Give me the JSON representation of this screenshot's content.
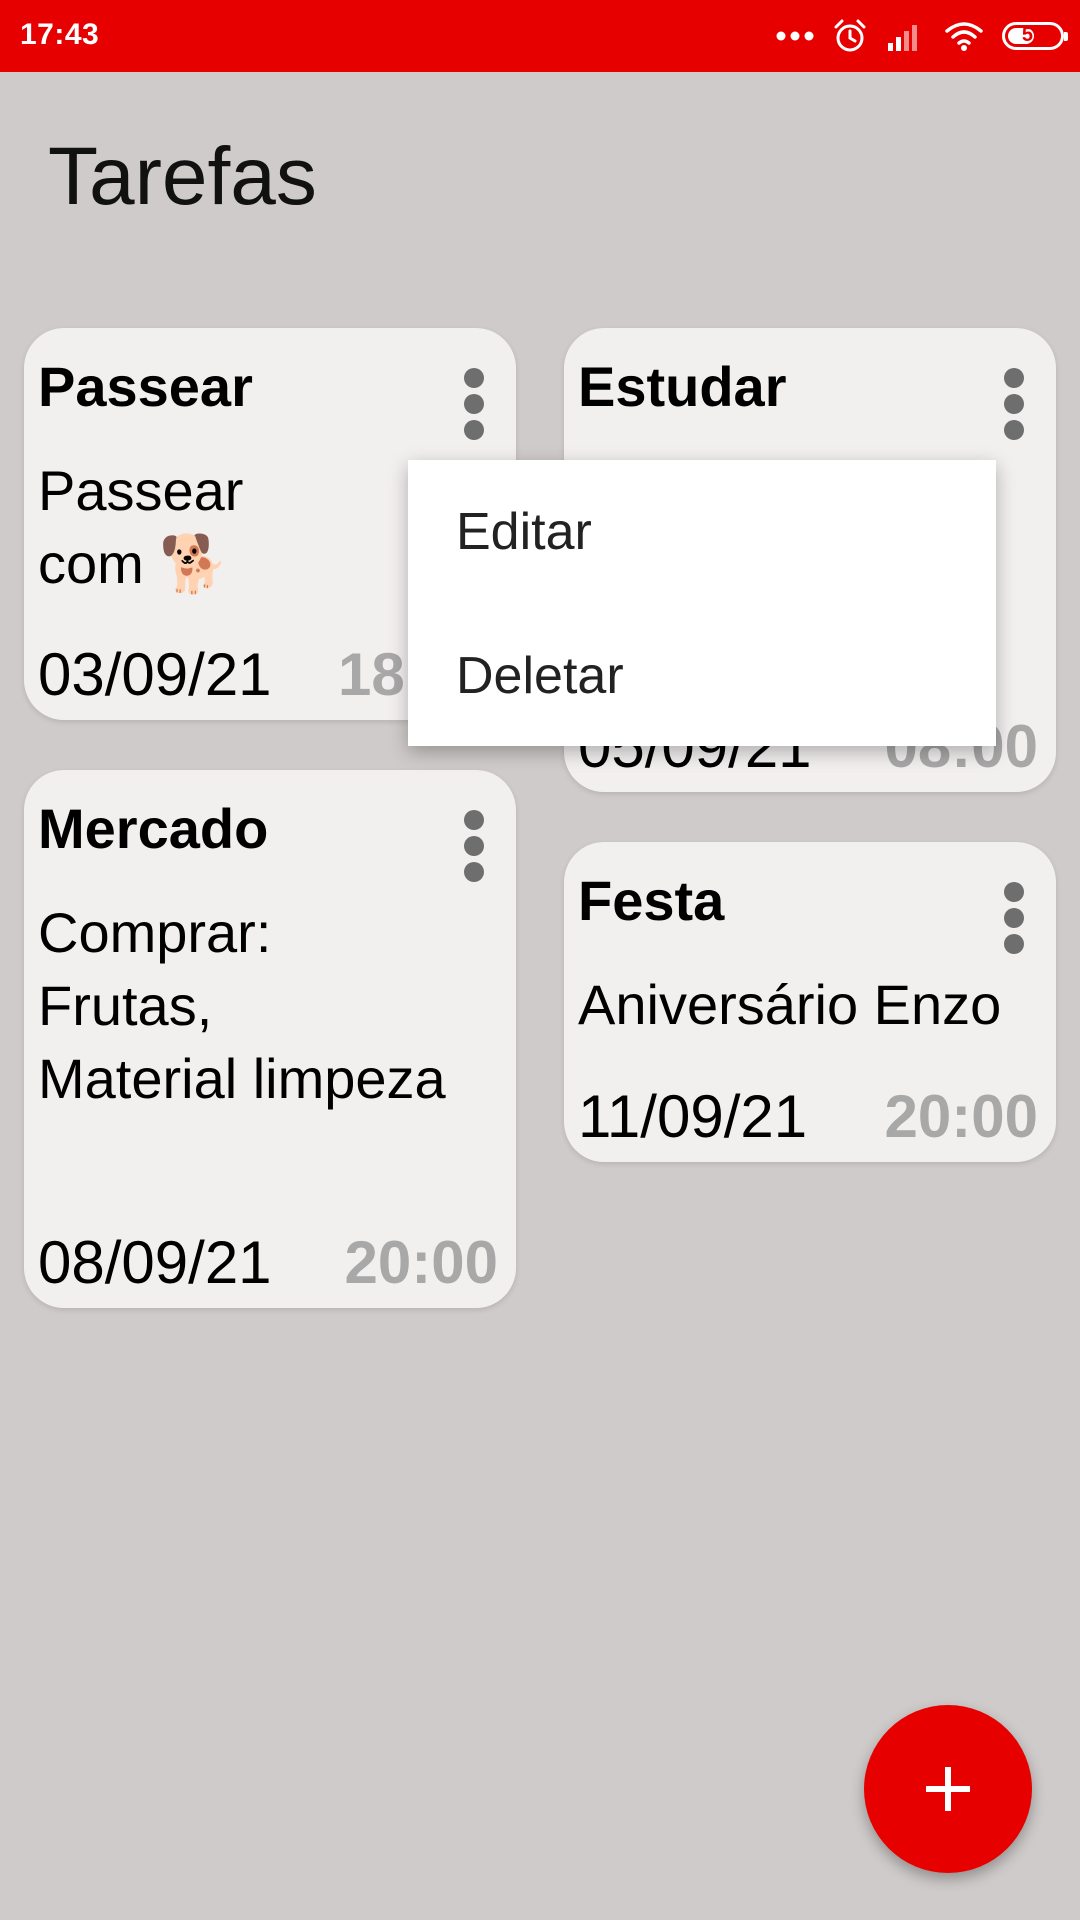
{
  "status_bar": {
    "time": "17:43",
    "battery": "51",
    "battery_level": 0.51,
    "icons": [
      "more-dots-icon",
      "alarm-icon",
      "signal-icon",
      "wifi-icon",
      "battery-icon"
    ]
  },
  "header": {
    "title": "Tarefas"
  },
  "tasks": [
    {
      "title": "Passear",
      "description": "Passear\ncom 🐕",
      "date": "03/09/21",
      "time": "18"
    },
    {
      "title": "Estudar",
      "description": "",
      "date": "05/09/21",
      "time": "08:00"
    },
    {
      "title": "Mercado",
      "description": "Comprar:\nFrutas,\nMaterial limpeza",
      "date": "08/09/21",
      "time": "20:00"
    },
    {
      "title": "Festa",
      "description": "Aniversário Enzo",
      "date": "11/09/21",
      "time": "20:00"
    }
  ],
  "context_menu": {
    "items": [
      "Editar",
      "Deletar"
    ]
  },
  "fab": {
    "icon": "plus-icon"
  },
  "colors": {
    "accent": "#e60000",
    "background": "#d0cbcb",
    "card": "#f2efef",
    "time_text": "#a8a8a8"
  }
}
